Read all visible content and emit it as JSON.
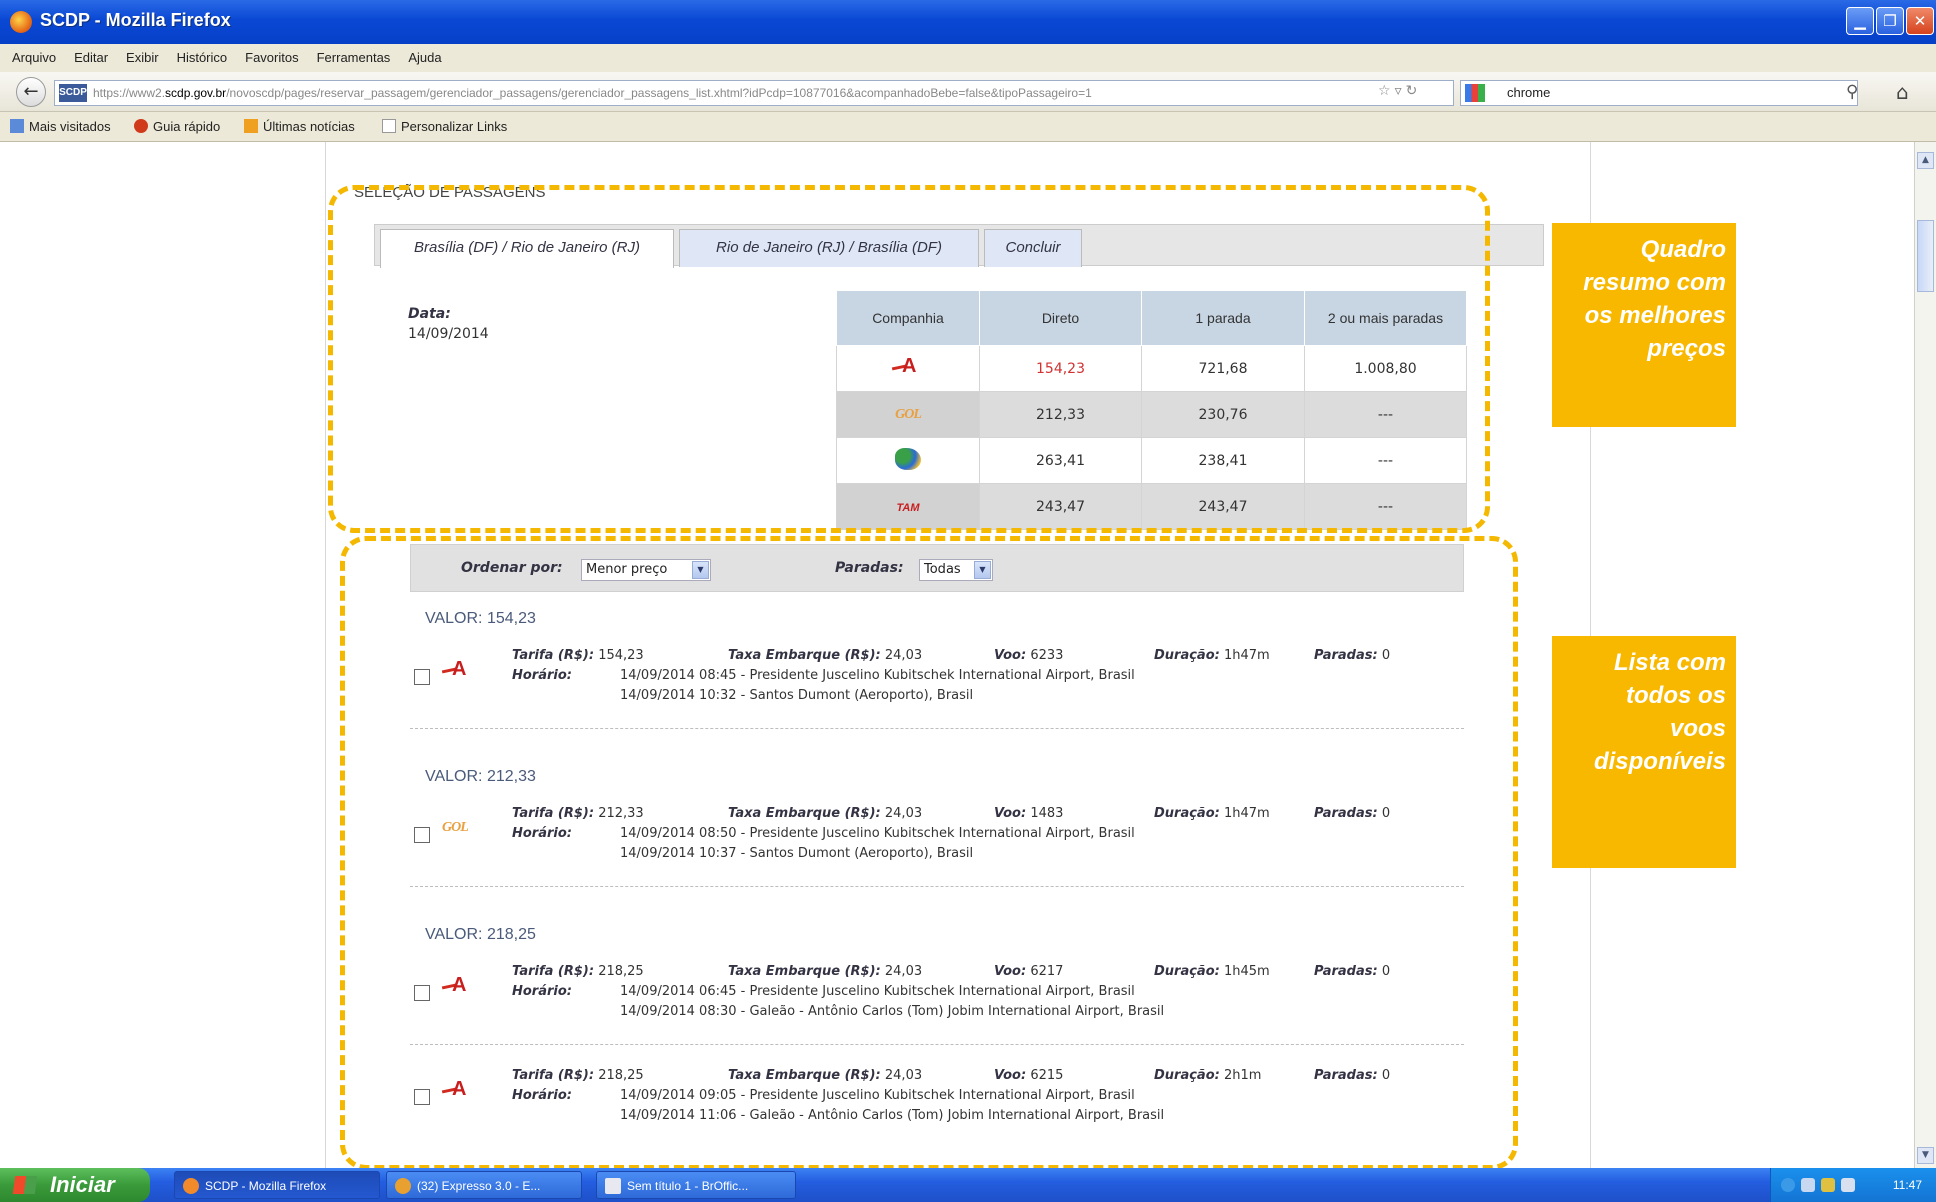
{
  "window": {
    "title": "SCDP - Mozilla Firefox"
  },
  "menu": [
    "Arquivo",
    "Editar",
    "Exibir",
    "Histórico",
    "Favoritos",
    "Ferramentas",
    "Ajuda"
  ],
  "nav": {
    "site_badge": "SCDP",
    "url_prefix": "https://www2.",
    "url_domain": "scdp.gov.br",
    "url_rest": "/novoscdp/pages/reservar_passagem/gerenciador_passagens/gerenciador_passagens_list.xhtml?idPcdp=10877016&acompanhadoBebe=false&tipoPassageiro=1",
    "search_value": "chrome"
  },
  "bookmarks": [
    "Mais visitados",
    "Guia rápido",
    "Últimas notícias",
    "Personalizar Links"
  ],
  "content": {
    "section_title": "SELEÇÃO DE PASSAGENS",
    "tabs": [
      "Brasília (DF) / Rio de Janeiro (RJ)",
      "Rio de Janeiro (RJ) / Brasília (DF)",
      "Concluir"
    ],
    "date_label": "Data:",
    "date_value": "14/09/2014",
    "price_table": {
      "headers": [
        "Companhia",
        "Direto",
        "1 parada",
        "2 ou mais paradas"
      ],
      "rows": [
        {
          "airline_icon": "tam-logo",
          "direto": "154,23",
          "uma": "721,68",
          "duas": "1.008,80"
        },
        {
          "airline_icon": "gol-logo",
          "logo_text": "GOL",
          "direto": "212,33",
          "uma": "230,76",
          "duas": "---"
        },
        {
          "airline_icon": "azul-logo",
          "direto": "263,41",
          "uma": "238,41",
          "duas": "---"
        },
        {
          "airline_icon": "tam-text-logo",
          "logo_text": "TAM",
          "direto": "243,47",
          "uma": "243,47",
          "duas": "---"
        }
      ]
    },
    "filter": {
      "order_label": "Ordenar por:",
      "order_value": "Menor preço",
      "stops_label": "Paradas:",
      "stops_value": "Todas"
    },
    "labels": {
      "tarifa": "Tarifa (R$):",
      "taxa": "Taxa Embarque (R$):",
      "voo": "Voo:",
      "duracao": "Duração:",
      "paradas": "Paradas:",
      "horario": "Horário:"
    },
    "groups": [
      {
        "valor": "VALOR: 154,23"
      },
      {
        "valor": "VALOR: 212,33"
      },
      {
        "valor": "VALOR: 218,25"
      }
    ],
    "flights": [
      {
        "airline_icon": "tam-logo",
        "tarifa": "154,23",
        "taxa": "24,03",
        "voo": "6233",
        "duracao": "1h47m",
        "paradas": "0",
        "partida": "14/09/2014 08:45 - Presidente Juscelino Kubitschek International Airport, Brasil",
        "chegada": "14/09/2014 10:32 - Santos Dumont (Aeroporto), Brasil"
      },
      {
        "airline_icon": "gol-logo",
        "logo_text": "GOL",
        "tarifa": "212,33",
        "taxa": "24,03",
        "voo": "1483",
        "duracao": "1h47m",
        "paradas": "0",
        "partida": "14/09/2014 08:50 - Presidente Juscelino Kubitschek International Airport, Brasil",
        "chegada": "14/09/2014 10:37 - Santos Dumont (Aeroporto), Brasil"
      },
      {
        "airline_icon": "tam-logo",
        "tarifa": "218,25",
        "taxa": "24,03",
        "voo": "6217",
        "duracao": "1h45m",
        "paradas": "0",
        "partida": "14/09/2014 06:45 - Presidente Juscelino Kubitschek International Airport, Brasil",
        "chegada": "14/09/2014 08:30 - Galeão - Antônio Carlos (Tom) Jobim International Airport, Brasil"
      },
      {
        "airline_icon": "tam-logo",
        "tarifa": "218,25",
        "taxa": "24,03",
        "voo": "6215",
        "duracao": "2h1m",
        "paradas": "0",
        "partida": "14/09/2014 09:05 - Presidente Juscelino Kubitschek International Airport, Brasil",
        "chegada": "14/09/2014 11:06 - Galeão - Antônio Carlos (Tom) Jobim International Airport, Brasil"
      }
    ]
  },
  "callouts": [
    [
      "Quadro",
      "resumo com",
      "os melhores",
      "preços"
    ],
    [
      "Lista com",
      "todos os",
      "voos",
      "disponíveis"
    ]
  ],
  "taskbar": {
    "start_label": "Iniciar",
    "tasks": [
      "SCDP - Mozilla Firefox",
      "(32) Expresso 3.0 - E...",
      "Sem título 1 - BrOffic..."
    ],
    "clock": "11:47"
  },
  "colors": {
    "accent_yellow": "#f9b800",
    "tam_red": "#c81e1e",
    "table_header": "#c8d6e4"
  }
}
